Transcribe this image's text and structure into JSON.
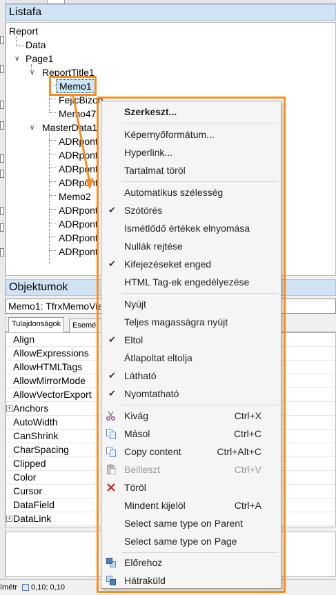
{
  "tree_panel": {
    "title": "Listafa",
    "nodes": [
      "Report",
      "Data",
      "Page1",
      "ReportTitle1",
      "Memo1",
      "FejlcBizon...",
      "Memo47",
      "MasterData1",
      "ADRpont",
      "ADRpont",
      "ADRpont",
      "ADRpont",
      "Memo2",
      "ADRpont",
      "ADRpont",
      "ADRpont",
      "ADRpont"
    ]
  },
  "objects_panel": {
    "title": "Objektumok",
    "selected_object": "Memo1: TfrxMemoVie",
    "tabs": [
      "Tulajdonságok",
      "Eseméı"
    ],
    "properties": [
      "Align",
      "AllowExpressions",
      "AllowHTMLTags",
      "AllowMirrorMode",
      "AllowVectorExport",
      "Anchors",
      "AutoWidth",
      "CanShrink",
      "CharSpacing",
      "Clipped",
      "Color",
      "Cursor",
      "DataField",
      "DataLink"
    ]
  },
  "status_bar": {
    "left_text": "ímétr",
    "coords": "0,10; 0,10"
  },
  "context_menu": {
    "items": [
      {
        "label": "Szerkeszt...",
        "bold": true
      },
      {
        "separator": true
      },
      {
        "label": "Képernyőformátum..."
      },
      {
        "label": "Hyperlink..."
      },
      {
        "label": "Tartalmat töröl"
      },
      {
        "separator": true
      },
      {
        "label": "Automatikus szélesség"
      },
      {
        "label": "Szótörés",
        "checked": true
      },
      {
        "label": "Ismétlődő értékek elnyomása"
      },
      {
        "label": "Nullák rejtése"
      },
      {
        "label": "Kifejezéseket enged",
        "checked": true
      },
      {
        "label": "HTML Tag-ek engedélyezése"
      },
      {
        "separator": true
      },
      {
        "label": "Nyújt"
      },
      {
        "label": "Teljes magasságra nyújt"
      },
      {
        "label": "Eltol",
        "checked": true
      },
      {
        "label": "Átlapoltat eltolja"
      },
      {
        "label": "Látható",
        "checked": true
      },
      {
        "label": "Nyomtatható",
        "checked": true
      },
      {
        "separator": true
      },
      {
        "label": "Kivág",
        "shortcut": "Ctrl+X",
        "icon": "scissors-icon"
      },
      {
        "label": "Másol",
        "shortcut": "Ctrl+C",
        "icon": "copy-icon"
      },
      {
        "label": "Copy content",
        "shortcut": "Ctrl+Alt+C",
        "icon": "copy-content-icon"
      },
      {
        "label": "Beilleszt",
        "shortcut": "Ctrl+V",
        "icon": "paste-icon",
        "disabled": true
      },
      {
        "label": "Töröl",
        "icon": "delete-icon"
      },
      {
        "label": "Mindent kijelöl",
        "shortcut": "Ctrl+A"
      },
      {
        "label": "Select same type on Parent"
      },
      {
        "label": "Select same type on Page"
      },
      {
        "separator": true
      },
      {
        "label": "Előrehoz",
        "icon": "bring-to-front-icon"
      },
      {
        "label": "Hátraküld",
        "icon": "send-to-back-icon"
      }
    ]
  },
  "colors": {
    "annotation": "#ff8c1a",
    "panel_header": "#cfe3f5",
    "selection": "#cde6fb",
    "delete_red": "#d01a1a"
  }
}
